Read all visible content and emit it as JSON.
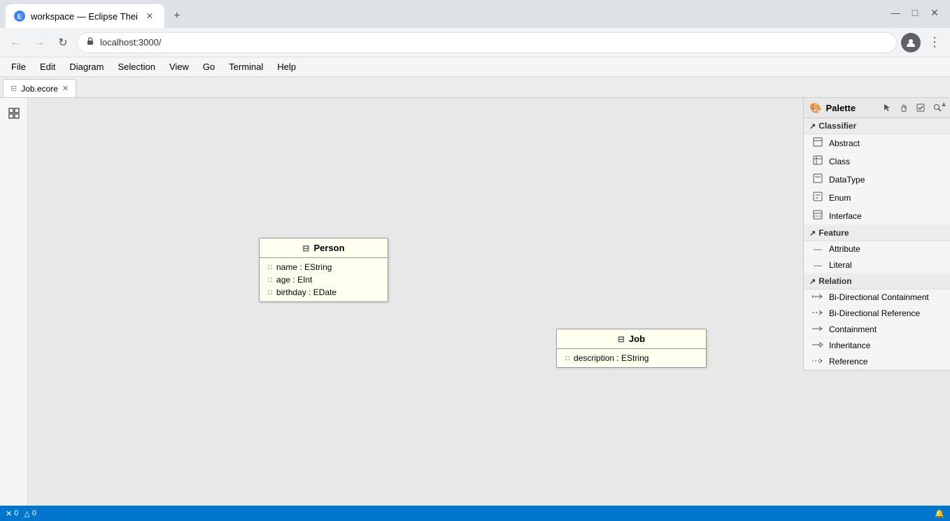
{
  "browser": {
    "tab_title": "workspace — Eclipse Thei",
    "tab_favicon": "E",
    "new_tab_label": "+",
    "url": "localhost:3000/",
    "back_disabled": true,
    "forward_disabled": true,
    "window_controls": [
      "—",
      "□",
      "✕"
    ]
  },
  "menu": {
    "items": [
      "File",
      "Edit",
      "Diagram",
      "Selection",
      "View",
      "Go",
      "Terminal",
      "Help"
    ]
  },
  "editor": {
    "tab_label": "Job.ecore",
    "tab_icon": "⊟"
  },
  "diagram": {
    "person_class": {
      "name": "Person",
      "icon": "⊟",
      "attributes": [
        {
          "icon": "□",
          "text": "name : EString"
        },
        {
          "icon": "□",
          "text": "age : EInt"
        },
        {
          "icon": "□",
          "text": "birthday : EDate"
        }
      ]
    },
    "job_class": {
      "name": "Job",
      "icon": "⊟",
      "attributes": [
        {
          "icon": "□",
          "text": "description : EString"
        }
      ]
    }
  },
  "palette": {
    "title": "Palette",
    "tools": [
      "cursor",
      "hand",
      "checkbox",
      "search"
    ],
    "sections": {
      "classifier": {
        "label": "Classifier",
        "icon": "↗",
        "items": [
          {
            "icon": "◈",
            "label": "Abstract"
          },
          {
            "icon": "⊟",
            "label": "Class"
          },
          {
            "icon": "◈",
            "label": "DataType"
          },
          {
            "icon": "◈",
            "label": "Enum"
          },
          {
            "icon": "⊟",
            "label": "Interface"
          }
        ]
      },
      "feature": {
        "label": "Feature",
        "icon": "↗",
        "items": [
          {
            "icon": "—",
            "label": "Attribute"
          },
          {
            "icon": "—",
            "label": "Literal"
          }
        ]
      },
      "relation": {
        "label": "Relation",
        "icon": "↗",
        "items": [
          {
            "icon": "⇒",
            "label": "Bi-Directional Containment"
          },
          {
            "icon": "⇒",
            "label": "Bi-Directional Reference"
          },
          {
            "icon": "⇒",
            "label": "Containment"
          },
          {
            "icon": "⊕",
            "label": "Inheritance"
          },
          {
            "icon": "⇒",
            "label": "Reference"
          }
        ]
      }
    }
  },
  "status_bar": {
    "errors": "0",
    "warnings": "0",
    "error_icon": "✕",
    "warning_icon": "△",
    "bell_icon": "🔔"
  }
}
